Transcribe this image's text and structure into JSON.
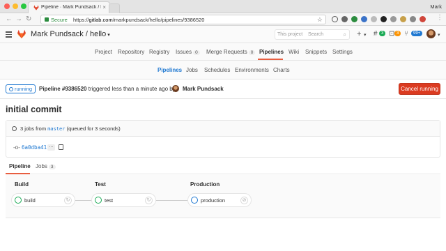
{
  "browser": {
    "tab_title": "Pipeline · Mark Pundsack / hello",
    "tab_close": "×",
    "user_name": "Mark",
    "secure_label": "Secure",
    "url_scheme": "https://",
    "url_host": "gitlab.com",
    "url_path": "/markpundsack/hello/pipelines/9386520"
  },
  "header": {
    "project_title": "Mark Pundsack / hello",
    "search_scope": "This project",
    "search_placeholder": "Search",
    "todo_count": "3",
    "issues_count": "3",
    "mr_count": "99+"
  },
  "project_nav": {
    "items": [
      {
        "label": "Project"
      },
      {
        "label": "Repository"
      },
      {
        "label": "Registry"
      },
      {
        "label": "Issues",
        "count": "0"
      },
      {
        "label": "Merge Requests",
        "count": "0"
      },
      {
        "label": "Pipelines"
      },
      {
        "label": "Wiki"
      },
      {
        "label": "Snippets"
      },
      {
        "label": "Settings"
      }
    ]
  },
  "sub_nav": {
    "items": [
      "Pipelines",
      "Jobs",
      "Schedules",
      "Environments",
      "Charts"
    ]
  },
  "pipeline": {
    "status": "running",
    "id_label": "Pipeline #9386520",
    "triggered_text": "triggered less than a minute ago by",
    "author": "Mark Pundsack",
    "cancel_label": "Cancel running",
    "commit_title": "initial commit",
    "jobs_prefix": "3 jobs from",
    "branch": "master",
    "jobs_suffix": "(queued for 3 seconds)",
    "sha": "6a0dba41",
    "ellipsis": "..."
  },
  "tabs": {
    "pipeline": "Pipeline",
    "jobs": "Jobs",
    "jobs_count": "3"
  },
  "stages": [
    {
      "title": "Build",
      "job": "build",
      "status": "success"
    },
    {
      "title": "Test",
      "job": "test",
      "status": "success"
    },
    {
      "title": "Production",
      "job": "production",
      "status": "running"
    }
  ],
  "colors": {
    "accent": "#e75e40",
    "link": "#1f78d1",
    "success": "#1aaa55",
    "danger": "#db3b21"
  }
}
